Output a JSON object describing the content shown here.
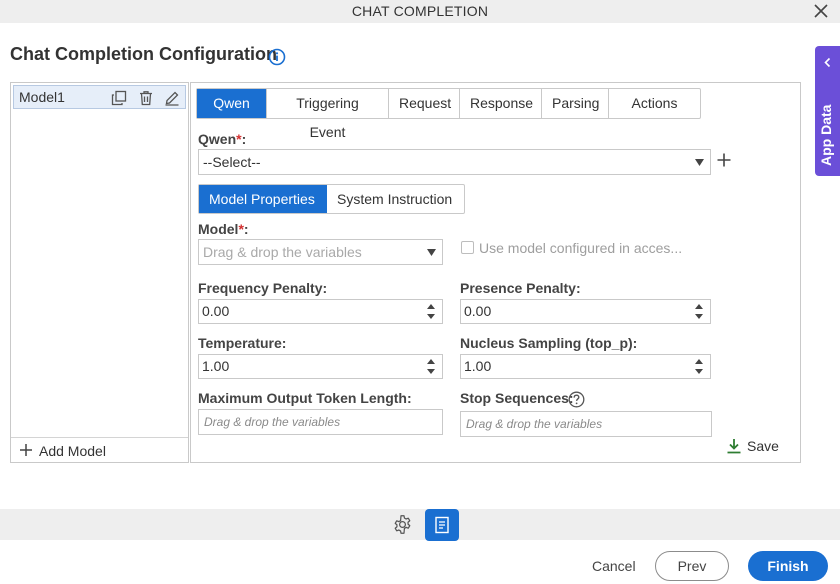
{
  "window": {
    "title": "CHAT COMPLETION"
  },
  "page": {
    "title": "Chat Completion Configuration"
  },
  "side_tab": {
    "label": "App Data"
  },
  "models": {
    "items": [
      {
        "label": "Model1"
      }
    ],
    "add_label": "Add Model"
  },
  "tabs": [
    "Qwen",
    "Triggering Event",
    "Request",
    "Response",
    "Parsing",
    "Actions"
  ],
  "qwen": {
    "label": "Qwen",
    "required_mark": "*",
    "colon": ":",
    "select_value": "--Select--"
  },
  "subtabs": [
    "Model Properties",
    "System Instruction"
  ],
  "model": {
    "label": "Model",
    "required_mark": "*",
    "colon": ":",
    "placeholder": "Drag & drop the variables",
    "use_model_label": "Use model configured in acces..."
  },
  "fields": {
    "frequency_penalty": {
      "label": "Frequency Penalty:",
      "value": "0.00"
    },
    "presence_penalty": {
      "label": "Presence Penalty:",
      "value": "0.00"
    },
    "temperature": {
      "label": "Temperature:",
      "value": "1.00"
    },
    "top_p": {
      "label": "Nucleus Sampling (top_p):",
      "value": "1.00"
    },
    "max_tokens": {
      "label": "Maximum Output Token Length:",
      "placeholder": "Drag & drop the variables"
    },
    "stop_sequences": {
      "label": "Stop Sequences:",
      "placeholder": "Drag & drop the variables"
    }
  },
  "save_label": "Save",
  "footer": {
    "cancel": "Cancel",
    "prev": "Prev",
    "finish": "Finish"
  },
  "colors": {
    "accent": "#1a6fd1",
    "app_data": "#6b4fd8",
    "required": "#d32f2f",
    "save_icon": "#2e7d32"
  },
  "icons": [
    "close-icon",
    "info-icon",
    "chevron-left-icon",
    "copy-icon",
    "trash-icon",
    "edit-icon",
    "plus-icon",
    "caret-down-icon",
    "spinner-icon",
    "help-icon",
    "download-icon",
    "gear-icon",
    "document-icon"
  ]
}
